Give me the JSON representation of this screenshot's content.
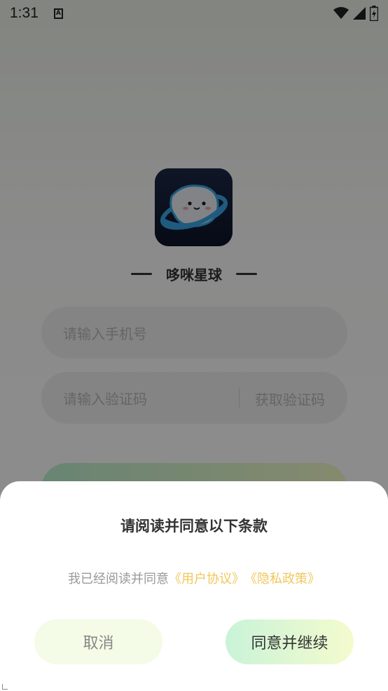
{
  "status_bar": {
    "time": "1:31",
    "notification_letter": "A"
  },
  "app": {
    "name": "哆咪星球"
  },
  "login_form": {
    "phone_placeholder": "请输入手机号",
    "code_placeholder": "请输入验证码",
    "get_code_label": "获取验证码"
  },
  "dialog": {
    "title": "请阅读并同意以下条款",
    "agreement_prefix": "我已经阅读并同意",
    "user_agreement_link": "《用户协议》",
    "privacy_policy_link": "《隐私政策》",
    "cancel_label": "取消",
    "agree_label": "同意并继续"
  },
  "colors": {
    "link": "#f0c75a",
    "accent_green": "#c9f3d8",
    "accent_yellow": "#f4fbcd"
  }
}
